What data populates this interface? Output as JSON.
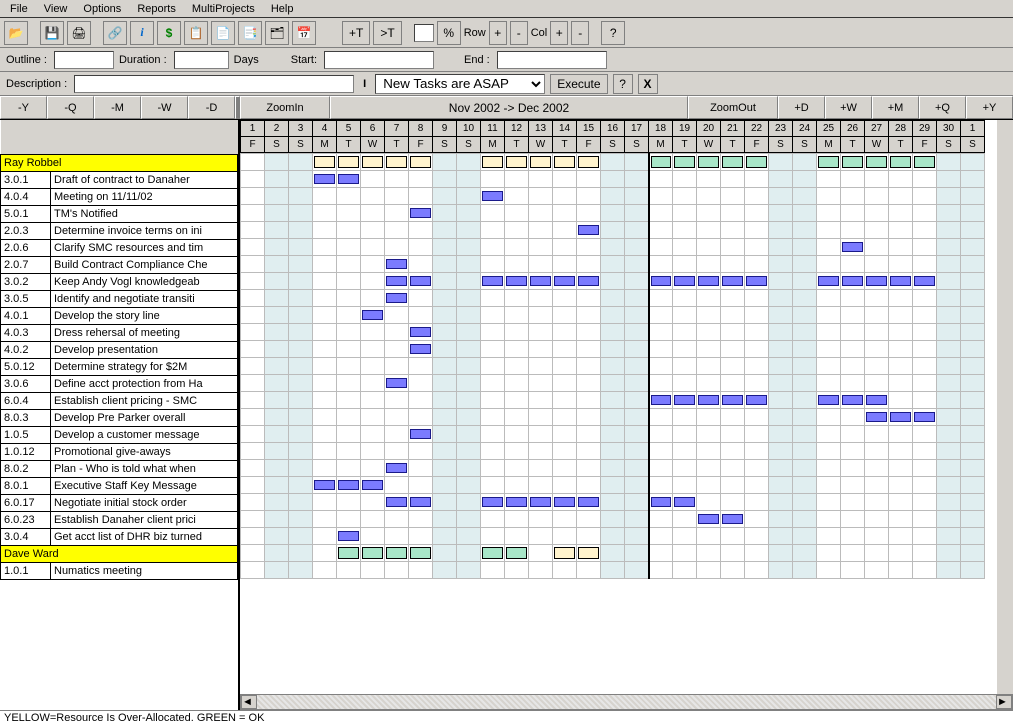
{
  "menu": [
    "File",
    "View",
    "Options",
    "Reports",
    "MultiProjects",
    "Help"
  ],
  "toolbar_icons": [
    "open",
    "save",
    "print",
    "link",
    "info",
    "dollar",
    "plan",
    "sheet",
    "copy",
    "tree",
    "cal"
  ],
  "toolbar2": {
    "plusT": "+T",
    "minusT": ">T",
    "pct": "%",
    "row": "Row",
    "plus": "+",
    "minus": "-",
    "col": "Col",
    "help": "?"
  },
  "fields": {
    "outline": "Outline :",
    "outline_v": "",
    "duration": "Duration :",
    "duration_v": "",
    "days": "Days",
    "start": "Start:",
    "start_v": "",
    "end": "End :",
    "end_v": "",
    "desc": "Description :",
    "desc_v": "",
    "taskmode": "New Tasks are ASAP",
    "exec": "Execute",
    "q": "?",
    "x": "X"
  },
  "zoom": {
    "mY": "-Y",
    "mQ": "-Q",
    "mM": "-M",
    "mW": "-W",
    "mD": "-D",
    "in": "ZoomIn",
    "title": "Nov  2002 -> Dec  2002",
    "out": "ZoomOut",
    "pD": "+D",
    "pW": "+W",
    "pM": "+M",
    "pQ": "+Q",
    "pY": "+Y"
  },
  "day_nums": [
    "1",
    "2",
    "3",
    "4",
    "5",
    "6",
    "7",
    "8",
    "9",
    "10",
    "11",
    "12",
    "13",
    "14",
    "15",
    "16",
    "17",
    "18",
    "19",
    "20",
    "21",
    "22",
    "23",
    "24",
    "25",
    "26",
    "27",
    "28",
    "29",
    "30",
    "1"
  ],
  "day_dows": [
    "F",
    "S",
    "S",
    "M",
    "T",
    "W",
    "T",
    "F",
    "S",
    "S",
    "M",
    "T",
    "W",
    "T",
    "F",
    "S",
    "S",
    "M",
    "T",
    "W",
    "T",
    "F",
    "S",
    "S",
    "M",
    "T",
    "W",
    "T",
    "F",
    "S",
    "S"
  ],
  "weekend_cols": [
    1,
    2,
    8,
    9,
    15,
    16,
    22,
    23,
    29,
    30
  ],
  "break_col": 17,
  "tasks": [
    {
      "id": "",
      "name": "Ray Robbel",
      "resource": true,
      "bars": [
        {
          "s": 3,
          "e": 7,
          "res": "over"
        },
        {
          "s": 10,
          "e": 14,
          "res": "over"
        },
        {
          "s": 17,
          "e": 21,
          "res": "ok"
        },
        {
          "s": 24,
          "e": 28,
          "res": "ok"
        }
      ]
    },
    {
      "id": "3.0.1",
      "name": "Draft of contract to Danaher",
      "bars": [
        {
          "s": 3,
          "e": 4
        }
      ]
    },
    {
      "id": "4.0.4",
      "name": "Meeting on 11/11/02",
      "bars": [
        {
          "s": 10,
          "e": 10
        }
      ]
    },
    {
      "id": "5.0.1",
      "name": "TM's Notified",
      "bars": [
        {
          "s": 7,
          "e": 7
        }
      ]
    },
    {
      "id": "2.0.3",
      "name": "Determine invoice terms on ini",
      "bars": [
        {
          "s": 14,
          "e": 14
        }
      ]
    },
    {
      "id": "2.0.6",
      "name": "Clarify SMC resources and tim",
      "bars": [
        {
          "s": 25,
          "e": 25
        }
      ]
    },
    {
      "id": "2.0.7",
      "name": "Build Contract Compliance Che",
      "bars": [
        {
          "s": 6,
          "e": 6
        }
      ]
    },
    {
      "id": "3.0.2",
      "name": "Keep Andy Vogl knowledgeab",
      "bars": [
        {
          "s": 6,
          "e": 7
        },
        {
          "s": 10,
          "e": 14
        },
        {
          "s": 17,
          "e": 21
        },
        {
          "s": 24,
          "e": 28
        }
      ]
    },
    {
      "id": "3.0.5",
      "name": "Identify and negotiate transiti",
      "bars": [
        {
          "s": 6,
          "e": 6
        }
      ]
    },
    {
      "id": "4.0.1",
      "name": "Develop the story line",
      "bars": [
        {
          "s": 5,
          "e": 5
        }
      ]
    },
    {
      "id": "4.0.3",
      "name": "Dress rehersal of meeting",
      "bars": [
        {
          "s": 7,
          "e": 7
        }
      ]
    },
    {
      "id": "4.0.2",
      "name": "Develop presentation",
      "bars": [
        {
          "s": 7,
          "e": 7
        }
      ]
    },
    {
      "id": "5.0.12",
      "name": "Determine strategy for $2M",
      "bars": []
    },
    {
      "id": "3.0.6",
      "name": "Define acct protection from Ha",
      "bars": [
        {
          "s": 6,
          "e": 6
        }
      ]
    },
    {
      "id": "6.0.4",
      "name": "Establish client pricing - SMC",
      "bars": [
        {
          "s": 17,
          "e": 21
        },
        {
          "s": 24,
          "e": 26
        }
      ]
    },
    {
      "id": "8.0.3",
      "name": "Develop Pre Parker overall",
      "bars": [
        {
          "s": 26,
          "e": 28
        }
      ]
    },
    {
      "id": "1.0.5",
      "name": "Develop a customer message",
      "bars": [
        {
          "s": 7,
          "e": 7
        }
      ]
    },
    {
      "id": "1.0.12",
      "name": "Promotional give-aways",
      "bars": []
    },
    {
      "id": "8.0.2",
      "name": "Plan - Who is told what when",
      "bars": [
        {
          "s": 6,
          "e": 6
        }
      ]
    },
    {
      "id": "8.0.1",
      "name": "Executive Staff Key Message",
      "bars": [
        {
          "s": 3,
          "e": 5
        }
      ]
    },
    {
      "id": "6.0.17",
      "name": "Negotiate initial stock order",
      "bars": [
        {
          "s": 6,
          "e": 7
        },
        {
          "s": 10,
          "e": 14
        },
        {
          "s": 17,
          "e": 18
        }
      ]
    },
    {
      "id": "6.0.23",
      "name": "Establish Danaher client prici",
      "bars": [
        {
          "s": 19,
          "e": 20
        }
      ]
    },
    {
      "id": "3.0.4",
      "name": "Get acct list of DHR biz turned",
      "bars": [
        {
          "s": 4,
          "e": 4
        }
      ]
    },
    {
      "id": "",
      "name": "Dave Ward",
      "resource": true,
      "bars": [
        {
          "s": 4,
          "e": 7,
          "res": "ok"
        },
        {
          "s": 10,
          "e": 11,
          "res": "ok"
        },
        {
          "s": 13,
          "e": 14,
          "res": "over"
        }
      ]
    },
    {
      "id": "1.0.1",
      "name": "Numatics meeting",
      "bars": []
    }
  ],
  "status": "YELLOW=Resource Is Over-Allocated.   GREEN = OK"
}
